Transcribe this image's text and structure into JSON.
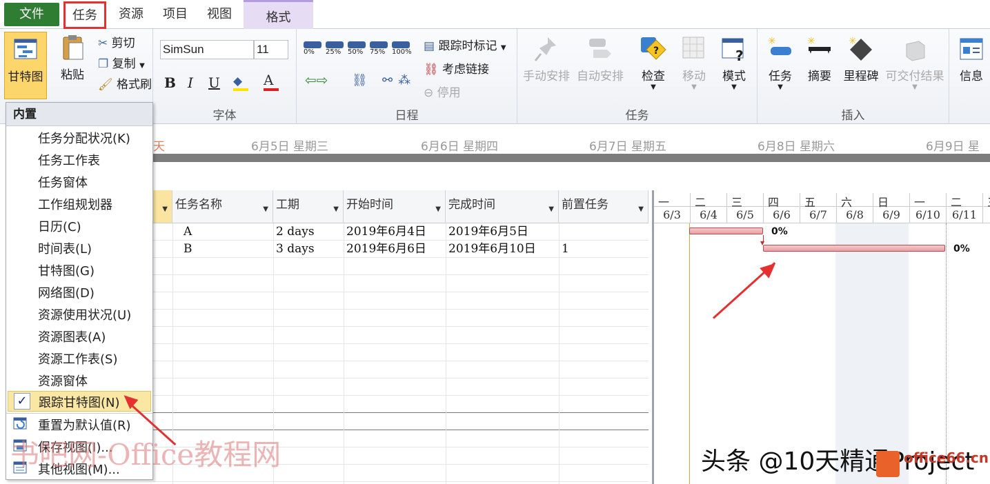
{
  "tabs": {
    "file": "文件",
    "task": "任务",
    "resource": "资源",
    "project": "项目",
    "view": "视图",
    "format": "格式"
  },
  "ribbon": {
    "gantt_button": "甘特图",
    "paste": "粘贴",
    "cut": "剪切",
    "copy": "复制",
    "format_painter": "格式刷",
    "font_name": "SimSun",
    "font_size": "11",
    "bold": "B",
    "italic": "I",
    "underline": "U",
    "font_color_letter": "A",
    "progress_0": "0%",
    "progress_25": "25%",
    "progress_50": "50%",
    "progress_75": "75%",
    "progress_100": "100%",
    "mark_on_track": "跟踪时标记",
    "respect_links": "考虑链接",
    "inactivate": "停用",
    "manual_schedule": "手动安排",
    "auto_schedule": "自动安排",
    "inspect": "检查",
    "move": "移动",
    "mode": "模式",
    "insert_task": "任务",
    "summary": "摘要",
    "milestone": "里程碑",
    "deliverable": "可交付结果",
    "information": "信息",
    "group_font": "字体",
    "group_schedule": "日程",
    "group_tasks": "任务",
    "group_insert": "插入"
  },
  "timeline": {
    "labels": [
      "6月5日  星期三",
      "6月6日  星期四",
      "6月7日  星期五",
      "6月8日  星期六",
      "6月9日  星"
    ],
    "partial": "天"
  },
  "table": {
    "headers": [
      "任务名称",
      "工期",
      "开始时间",
      "完成时间",
      "前置任务"
    ],
    "rows": [
      {
        "name": "A",
        "duration": "2 days",
        "start": "2019年6月4日",
        "finish": "2019年6月5日",
        "pred": ""
      },
      {
        "name": "B",
        "duration": "3 days",
        "start": "2019年6月6日",
        "finish": "2019年6月10日",
        "pred": "1"
      }
    ]
  },
  "gantt": {
    "weekdays": [
      "一",
      "二",
      "三",
      "四",
      "五",
      "六",
      "日",
      "一",
      "二",
      "三"
    ],
    "dates": [
      "6/3",
      "6/4",
      "6/5",
      "6/6",
      "6/7",
      "6/8",
      "6/9",
      "6/10",
      "6/11",
      "6"
    ],
    "bar_a_pct": "0%",
    "bar_b_pct": "0%"
  },
  "menu": {
    "header": "内置",
    "items": [
      "任务分配状况(K)",
      "任务工作表",
      "任务窗体",
      "工作组规划器",
      "日历(C)",
      "时间表(L)",
      "甘特图(G)",
      "网络图(D)",
      "资源使用状况(U)",
      "资源图表(A)",
      "资源工作表(S)",
      "资源窗体"
    ],
    "selected": "跟踪甘特图(N)",
    "check": "✓",
    "reset": "重置为默认值(R)",
    "save": "保存视图(I)...",
    "more": "其他视图(M)..."
  },
  "watermarks": {
    "left": "书吧网-Office教程网",
    "right": "头条 @10天精通Project",
    "logo": "office66.cn"
  }
}
